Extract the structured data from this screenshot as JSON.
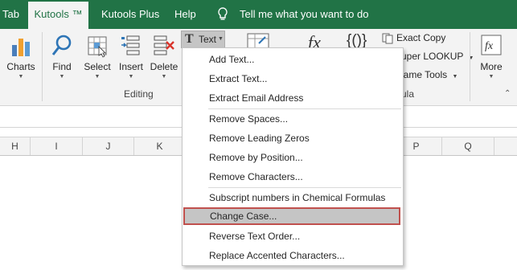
{
  "tabs": [
    "Tab",
    "Kutools ™",
    "Kutools Plus",
    "Help"
  ],
  "tell_me": "Tell me what you want to do",
  "ribbon": {
    "buttons": {
      "charts": "Charts",
      "find": "Find",
      "select": "Select",
      "insert": "Insert",
      "delete": "Delete",
      "more": "More"
    },
    "text_dropdown": "Text",
    "editing_group": "Editing",
    "exact_copy": "Exact Copy",
    "super_lookup": "uper LOOKUP",
    "name_tools": "lame Tools",
    "formula_group_partial": "ula",
    "fx_label": "fx",
    "braces_label": "{()}"
  },
  "columns": [
    "H",
    "I",
    "J",
    "K",
    "P",
    "Q"
  ],
  "menu": {
    "items": [
      "Add Text...",
      "Extract Text...",
      "Extract Email Address",
      "Remove Spaces...",
      "Remove Leading Zeros",
      "Remove by Position...",
      "Remove Characters...",
      "Subscript numbers in Chemical Formulas",
      "Change Case...",
      "Reverse Text Order...",
      "Replace Accented Characters..."
    ],
    "highlighted_index": 8
  },
  "colors": {
    "tabbar": "#217346",
    "ribbon_bg": "#f3f3f3",
    "highlight_border": "#c0504d",
    "highlight_bg": "#c5c5c5"
  }
}
